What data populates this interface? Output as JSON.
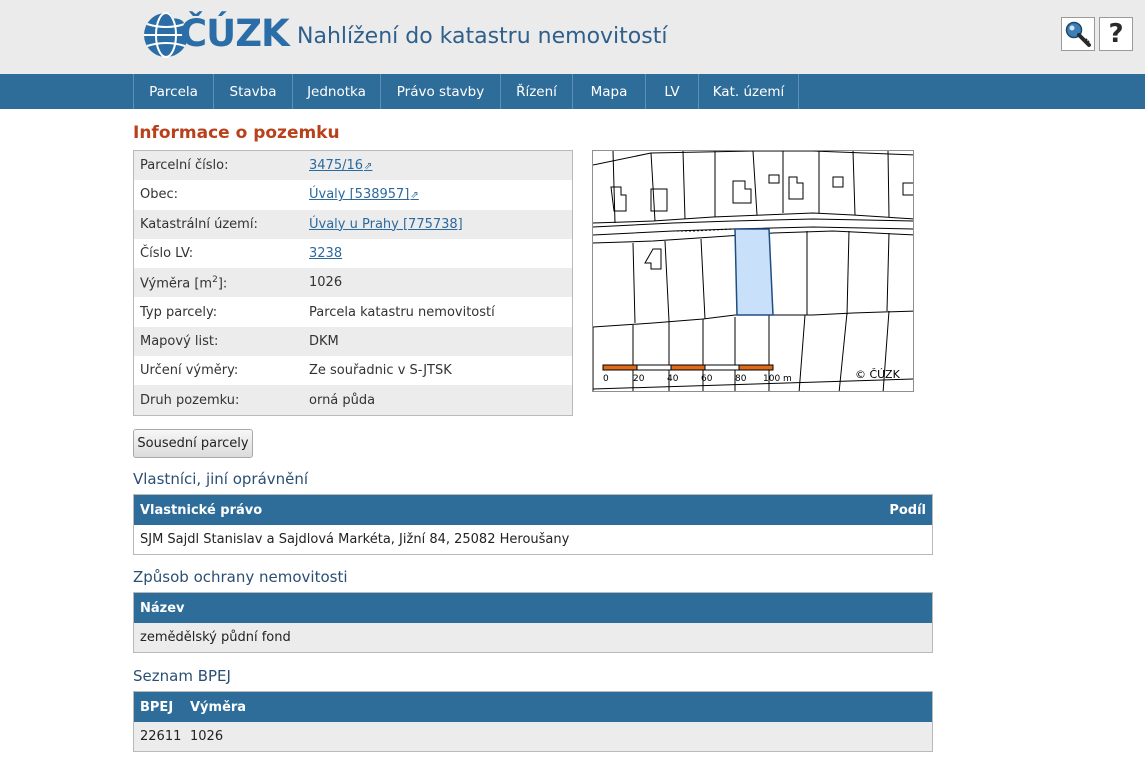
{
  "header": {
    "logo_text": "ČÚZK",
    "site_title": "Nahlížení do katastru nemovitostí",
    "search_icon": "search-key-icon",
    "help_label": "?"
  },
  "nav": {
    "items": [
      {
        "label": "Parcela"
      },
      {
        "label": "Stavba"
      },
      {
        "label": "Jednotka"
      },
      {
        "label": "Právo stavby"
      },
      {
        "label": "Řízení"
      },
      {
        "label": "Mapa"
      },
      {
        "label": "LV"
      },
      {
        "label": "Kat. území"
      }
    ]
  },
  "info": {
    "heading": "Informace o pozemku",
    "rows": [
      {
        "label": "Parcelní číslo:",
        "value": "3475/16"
      },
      {
        "label": "Obec:",
        "value": "Úvaly [538957]"
      },
      {
        "label": "Katastrální území:",
        "value": "Úvaly u Prahy [775738]"
      },
      {
        "label": "Číslo LV:",
        "value": "3238"
      },
      {
        "label": "Výměra [m",
        "label_sup": "2",
        "label_tail": "]:",
        "value": "1026"
      },
      {
        "label": "Typ parcely:",
        "value": "Parcela katastru nemovitostí"
      },
      {
        "label": "Mapový list:",
        "value": "DKM"
      },
      {
        "label": "Určení výměry:",
        "value": "Ze souřadnic v S-JTSK"
      },
      {
        "label": "Druh pozemku:",
        "value": "orná půda"
      }
    ]
  },
  "map": {
    "scale_labels": [
      "0",
      "20",
      "40",
      "60",
      "80",
      "100 m"
    ],
    "copyright": "© ČÚZK",
    "highlight_color": "#c9e0fb",
    "scale_color": "#e0691a"
  },
  "neighbors_button": "Sousední parcely",
  "owners": {
    "heading": "Vlastníci, jiní oprávnění",
    "col1": "Vlastnické právo",
    "col2": "Podíl",
    "row": "SJM Sajdl Stanislav a Sajdlová Markéta, Jižní 84, 25082 Heroušany"
  },
  "protection": {
    "heading": "Způsob ochrany nemovitosti",
    "col1": "Název",
    "row": "zemědělský půdní fond"
  },
  "bpej": {
    "heading": "Seznam BPEJ",
    "col1": "BPEJ",
    "col2": "Výměra",
    "row_bpej": "22611",
    "row_area": "1026"
  }
}
